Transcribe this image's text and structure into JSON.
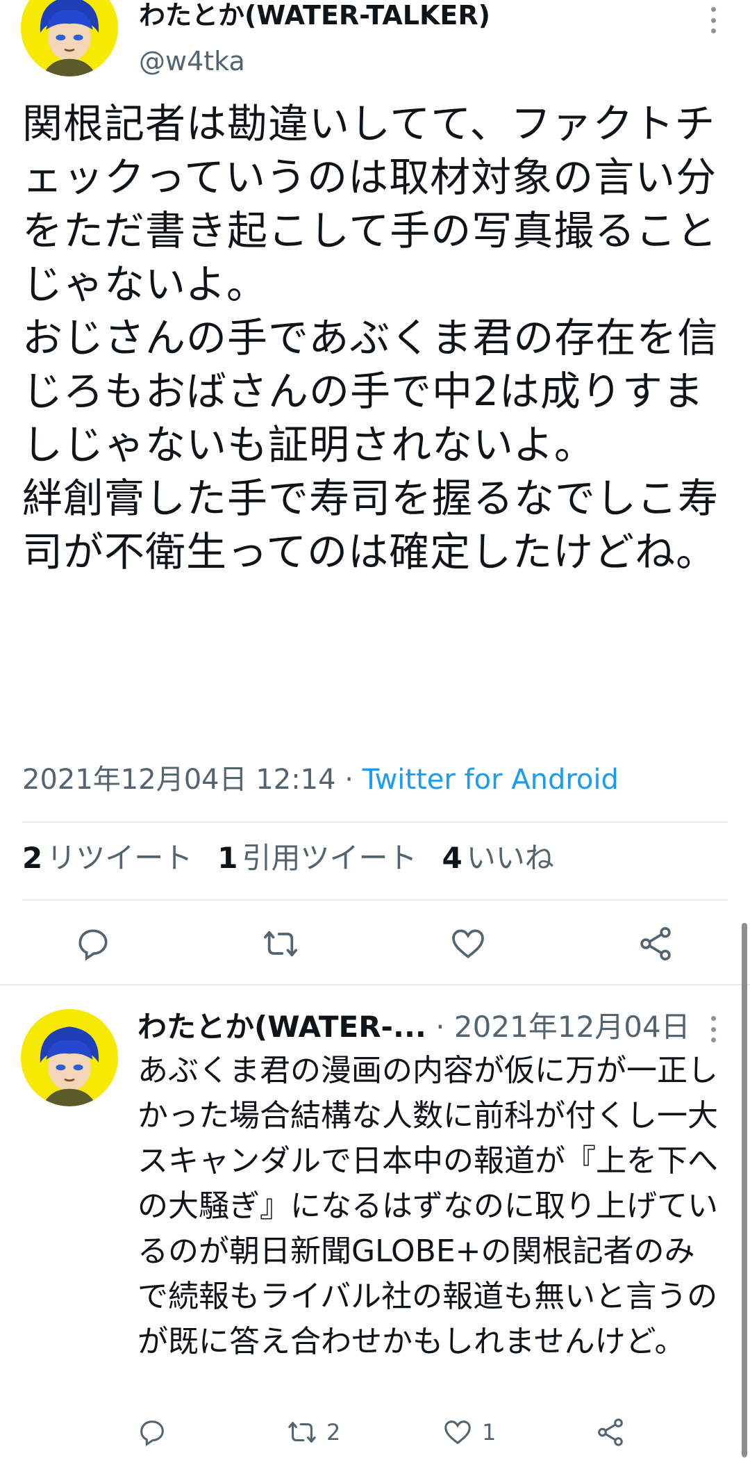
{
  "main_tweet": {
    "display_name": "わたとか(WATER-TALKER)",
    "handle": "@w4tka",
    "text": "関根記者は勘違いしてて、ファクトチェックっていうのは取材対象の言い分をただ書き起こして手の写真撮ることじゃないよ。\nおじさんの手であぶくま君の存在を信じろもおばさんの手で中2は成りすましじゃないも証明されないよ。\n絆創膏した手で寿司を握るなでしこ寿司が不衛生ってのは確定したけどね。",
    "timestamp": "2021年12月04日 12:14",
    "separator": " · ",
    "client": "Twitter for Android",
    "stats": {
      "retweets_count": "2",
      "retweets_label": "リツイート",
      "quotes_count": "1",
      "quotes_label": "引用ツイート",
      "likes_count": "4",
      "likes_label": "いいね"
    },
    "actions": [
      "reply-icon",
      "retweet-icon",
      "like-icon",
      "share-icon"
    ]
  },
  "reply_tweet": {
    "display_name": "わたとか(WATER-...",
    "separator": " · ",
    "date": "2021年12月04日",
    "text": "あぶくま君の漫画の内容が仮に万が一正しかった場合結構な人数に前科が付くし一大スキャンダルで日本中の報道が『上を下への大騒ぎ』になるはずなのに取り上げているのが朝日新聞GLOBE+の関根記者のみで続報もライバル社の報道も無いと言うのが既に答え合わせかもしれませんけど。",
    "retweet_count": "2",
    "like_count": "1"
  },
  "colors": {
    "text": "#0f1419",
    "muted": "#536471",
    "link": "#1d9bf0",
    "avatar_bg": "#f6ea00",
    "divider": "#e6ecf0"
  }
}
